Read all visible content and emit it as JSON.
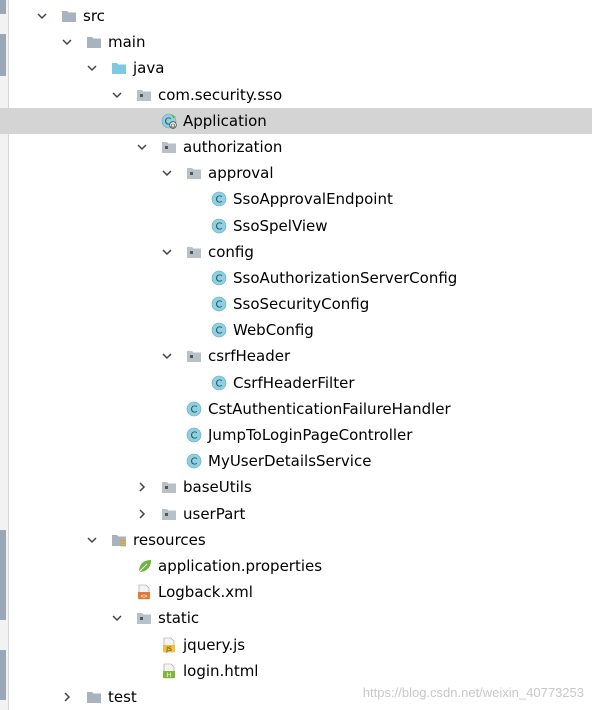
{
  "tree": [
    {
      "label": "src",
      "arrow": "down",
      "icon": "folder",
      "depth": 0
    },
    {
      "label": "main",
      "arrow": "down",
      "icon": "folder",
      "depth": 1
    },
    {
      "label": "java",
      "arrow": "down",
      "icon": "source-folder",
      "depth": 2
    },
    {
      "label": "com.security.sso",
      "arrow": "down",
      "icon": "package",
      "depth": 3
    },
    {
      "label": "Application",
      "arrow": "none",
      "icon": "spring-app-class",
      "depth": 4,
      "selected": true
    },
    {
      "label": "authorization",
      "arrow": "down",
      "icon": "package",
      "depth": 4
    },
    {
      "label": "approval",
      "arrow": "down",
      "icon": "package",
      "depth": 5
    },
    {
      "label": "SsoApprovalEndpoint",
      "arrow": "none",
      "icon": "class",
      "depth": 6
    },
    {
      "label": "SsoSpelView",
      "arrow": "none",
      "icon": "class",
      "depth": 6
    },
    {
      "label": "config",
      "arrow": "down",
      "icon": "package",
      "depth": 5
    },
    {
      "label": "SsoAuthorizationServerConfig",
      "arrow": "none",
      "icon": "class",
      "depth": 6
    },
    {
      "label": "SsoSecurityConfig",
      "arrow": "none",
      "icon": "class",
      "depth": 6
    },
    {
      "label": "WebConfig",
      "arrow": "none",
      "icon": "class",
      "depth": 6
    },
    {
      "label": "csrfHeader",
      "arrow": "down",
      "icon": "package",
      "depth": 5
    },
    {
      "label": "CsrfHeaderFilter",
      "arrow": "none",
      "icon": "class",
      "depth": 6
    },
    {
      "label": "CstAuthenticationFailureHandler",
      "arrow": "none",
      "icon": "class",
      "depth": 5
    },
    {
      "label": "JumpToLoginPageController",
      "arrow": "none",
      "icon": "class",
      "depth": 5
    },
    {
      "label": "MyUserDetailsService",
      "arrow": "none",
      "icon": "class",
      "depth": 5
    },
    {
      "label": "baseUtils",
      "arrow": "right",
      "icon": "package",
      "depth": 4
    },
    {
      "label": "userPart",
      "arrow": "right",
      "icon": "package",
      "depth": 4
    },
    {
      "label": "resources",
      "arrow": "down",
      "icon": "resources-folder",
      "depth": 2
    },
    {
      "label": "application.properties",
      "arrow": "none",
      "icon": "spring-properties",
      "depth": 3
    },
    {
      "label": "Logback.xml",
      "arrow": "none",
      "icon": "xml-file",
      "depth": 3
    },
    {
      "label": "static",
      "arrow": "down",
      "icon": "package",
      "depth": 3
    },
    {
      "label": "jquery.js",
      "arrow": "none",
      "icon": "js-file",
      "depth": 4
    },
    {
      "label": "login.html",
      "arrow": "none",
      "icon": "html-file",
      "depth": 4
    },
    {
      "label": "test",
      "arrow": "right",
      "icon": "folder",
      "depth": 1
    }
  ],
  "colors": {
    "selected_bg": "#d4d4d4",
    "class_icon": "#8fcfe0",
    "folder": "#a9b3bd",
    "source_folder": "#7ec8e3",
    "spring_green": "#6db33f"
  },
  "watermark": "https://blog.csdn.net/weixin_40773253"
}
